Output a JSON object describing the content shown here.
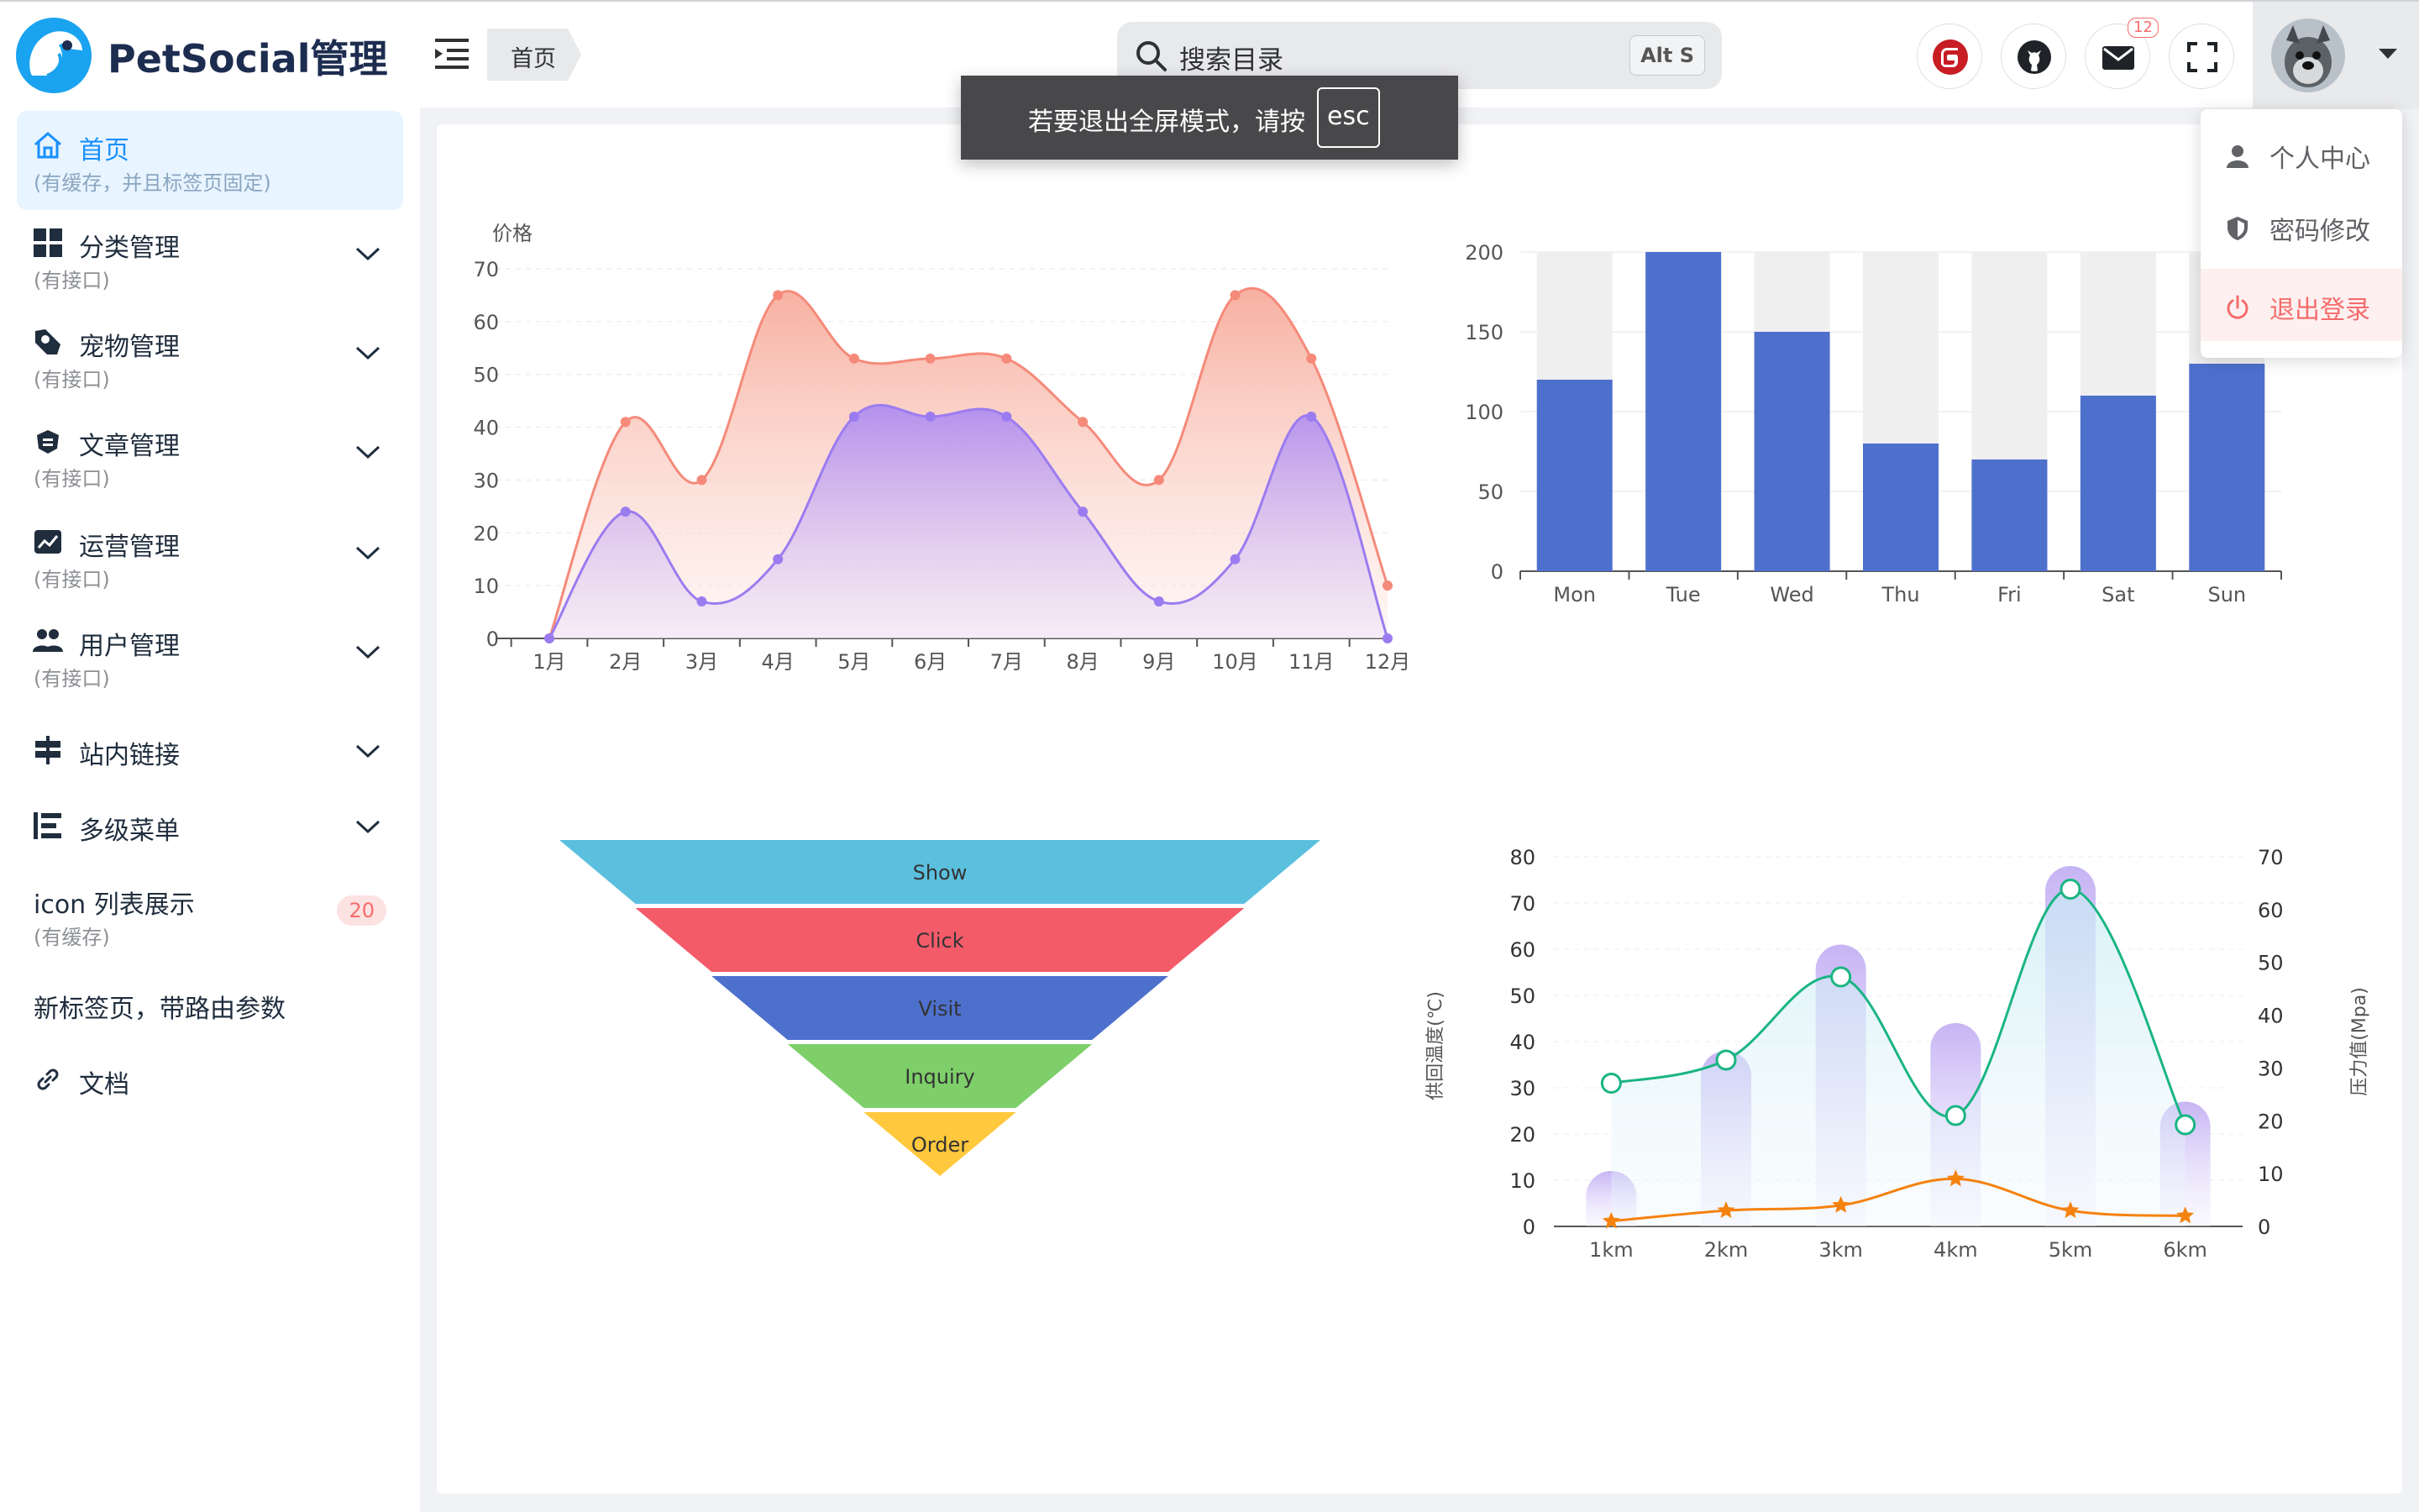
{
  "app": {
    "title": "PetSocial管理"
  },
  "header": {
    "breadcrumb": "首页",
    "search": {
      "placeholder": "搜索目录",
      "shortcut": "Alt S"
    },
    "mail_badge": "12"
  },
  "fullscreen_toast": {
    "text": "若要退出全屏模式，请按",
    "key": "esc"
  },
  "user_menu": {
    "items": [
      {
        "label": "个人中心",
        "icon": "user-icon"
      },
      {
        "label": "密码修改",
        "icon": "shield-icon"
      },
      {
        "label": "退出登录",
        "icon": "power-icon"
      }
    ]
  },
  "sidebar": {
    "items": [
      {
        "title": "首页",
        "subtitle": "(有缓存，并且标签页固定)",
        "icon": "home-icon",
        "active": true
      },
      {
        "title": "分类管理",
        "subtitle": "(有接口)",
        "icon": "grid-icon"
      },
      {
        "title": "宠物管理",
        "subtitle": "(有接口)",
        "icon": "pet-icon"
      },
      {
        "title": "文章管理",
        "subtitle": "(有接口)",
        "icon": "article-icon"
      },
      {
        "title": "运营管理",
        "subtitle": "(有接口)",
        "icon": "chart-icon"
      },
      {
        "title": "用户管理",
        "subtitle": "(有接口)",
        "icon": "users-icon"
      },
      {
        "title": "站内链接",
        "subtitle": "",
        "icon": "signpost-icon"
      },
      {
        "title": "多级菜单",
        "subtitle": "",
        "icon": "menu-icon"
      },
      {
        "title": "icon 列表展示",
        "subtitle": "(有缓存)",
        "icon": "",
        "badge": "20"
      },
      {
        "title": "新标签页，带路由参数",
        "subtitle": "",
        "icon": ""
      },
      {
        "title": "文档",
        "subtitle": "",
        "icon": "link-icon"
      }
    ]
  },
  "colors": {
    "accent": "#1890ff",
    "danger": "#f56c6c",
    "bar": "#4e70cd"
  },
  "chart_data": [
    {
      "type": "area",
      "ylabel": "价格",
      "ylim": [
        0,
        70
      ],
      "yticks": [
        0,
        10,
        20,
        30,
        40,
        50,
        60,
        70
      ],
      "categories": [
        "1月",
        "2月",
        "3月",
        "4月",
        "5月",
        "6月",
        "7月",
        "8月",
        "9月",
        "10月",
        "11月",
        "12月"
      ],
      "series": [
        {
          "values": [
            0,
            41,
            30,
            65,
            53,
            53,
            53,
            41,
            30,
            65,
            53,
            10
          ],
          "color": "#f58a7a"
        },
        {
          "values": [
            0,
            24,
            7,
            15,
            42,
            42,
            42,
            24,
            7,
            15,
            42,
            0
          ],
          "color": "#9b7cf0"
        }
      ]
    },
    {
      "type": "bar",
      "categories": [
        "Mon",
        "Tue",
        "Wed",
        "Thu",
        "Fri",
        "Sat",
        "Sun"
      ],
      "values": [
        120,
        200,
        150,
        80,
        70,
        110,
        130
      ],
      "ylim": [
        0,
        200
      ],
      "yticks": [
        0,
        50,
        100,
        150,
        200
      ],
      "background_bars": true,
      "color": "#4e70cd"
    },
    {
      "type": "funnel",
      "categories": [
        "Show",
        "Click",
        "Visit",
        "Inquiry",
        "Order"
      ],
      "colors": [
        "#5bc0de",
        "#f45b69",
        "#4e70cd",
        "#7ecf6a",
        "#ffc83d"
      ]
    },
    {
      "type": "bar+line",
      "categories": [
        "1km",
        "2km",
        "3km",
        "4km",
        "5km",
        "6km"
      ],
      "ylabel_left": "供回温度(℃)",
      "ylabel_right": "压力值(Mpa)",
      "ylim_left": [
        0,
        80
      ],
      "ylim_right": [
        0,
        70
      ],
      "yticks_left": [
        0,
        10,
        20,
        30,
        40,
        50,
        60,
        70,
        80
      ],
      "yticks_right": [
        0,
        10,
        20,
        30,
        40,
        50,
        60,
        70
      ],
      "series": [
        {
          "type": "bar",
          "values": [
            12,
            38,
            61,
            44,
            78,
            27
          ],
          "color": "#c9b8f5"
        },
        {
          "type": "line",
          "values": [
            31,
            36,
            54,
            24,
            73,
            22
          ],
          "color": "#1ab583"
        },
        {
          "type": "line",
          "axis": "right",
          "values": [
            1,
            3,
            4,
            9,
            3,
            2
          ],
          "color": "#f5820f"
        }
      ]
    }
  ]
}
